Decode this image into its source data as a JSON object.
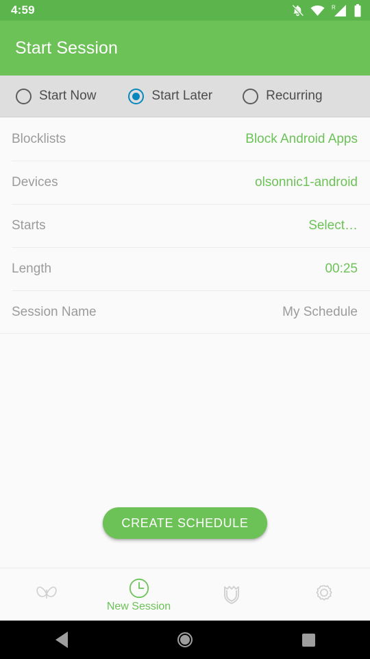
{
  "status_bar": {
    "time": "4:59",
    "icons": [
      "bell-off-icon",
      "wifi-icon",
      "cellular-signal-roaming-icon",
      "battery-icon"
    ],
    "roaming_label": "R",
    "background": "#5cb54c"
  },
  "app_bar": {
    "title": "Start Session",
    "background": "#6cc257"
  },
  "mode_selector": {
    "options": [
      {
        "label": "Start Now",
        "selected": false
      },
      {
        "label": "Start Later",
        "selected": true
      },
      {
        "label": "Recurring",
        "selected": false
      }
    ],
    "selected_color": "#0787be",
    "background": "#dedede"
  },
  "form": {
    "rows": [
      {
        "label": "Blocklists",
        "value": "Block Android Apps",
        "value_style": "accent"
      },
      {
        "label": "Devices",
        "value": "olsonnic1-android",
        "value_style": "accent"
      },
      {
        "label": "Starts",
        "value": "Select…",
        "value_style": "accent"
      },
      {
        "label": "Length",
        "value": "00:25",
        "value_style": "accent"
      },
      {
        "label": "Session Name",
        "value": "My Schedule",
        "value_style": "muted"
      }
    ],
    "accent_color": "#6cc257",
    "label_color": "#9b9b9b"
  },
  "cta": {
    "label": "CREATE SCHEDULE",
    "background": "#6cc257",
    "text_color": "#ffffff"
  },
  "bottom_nav": {
    "items": [
      {
        "icon": "butterfly-icon",
        "label": "",
        "active": false
      },
      {
        "icon": "clock-icon",
        "label": "New Session",
        "active": true
      },
      {
        "icon": "shield-icon",
        "label": "",
        "active": false
      },
      {
        "icon": "gear-icon",
        "label": "",
        "active": false
      }
    ],
    "active_color": "#6cc257",
    "inactive_color": "#cfcfcf"
  },
  "android_nav": {
    "buttons": [
      "back-button",
      "home-button",
      "recents-button"
    ]
  }
}
